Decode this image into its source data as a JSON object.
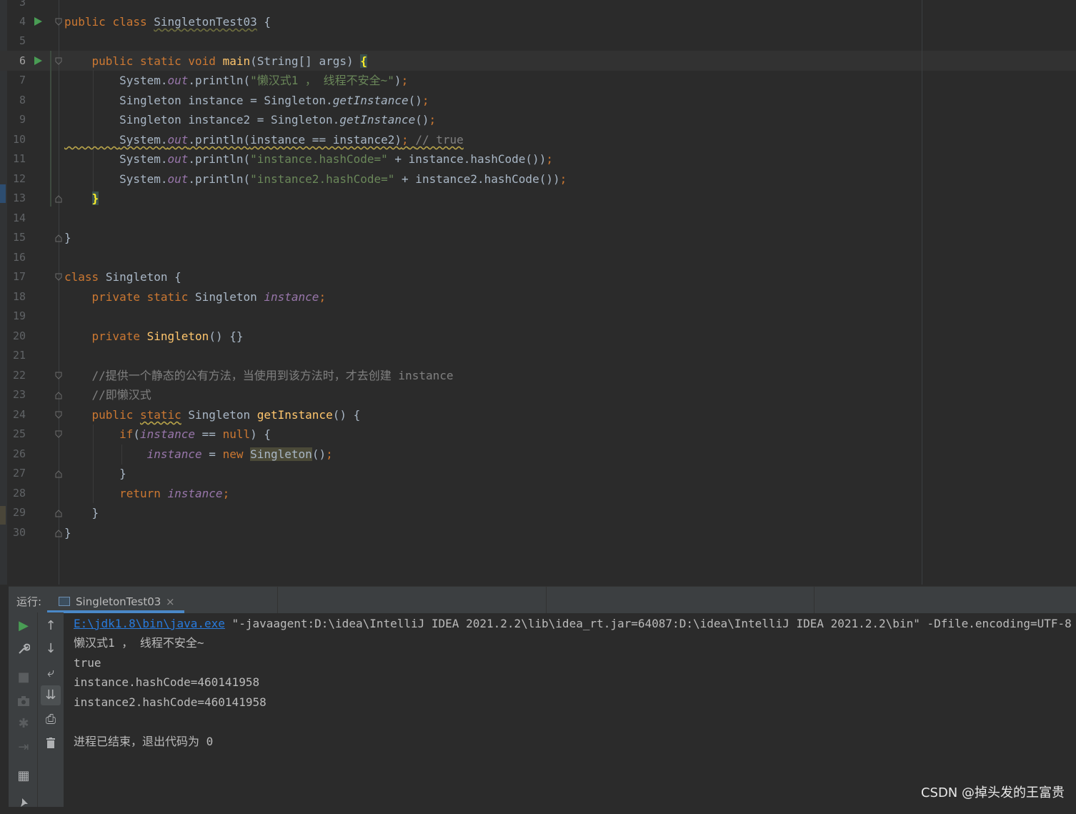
{
  "editor": {
    "lines": [
      {
        "n": "3"
      },
      {
        "n": "4"
      },
      {
        "n": "5"
      },
      {
        "n": "6"
      },
      {
        "n": "7"
      },
      {
        "n": "8"
      },
      {
        "n": "9"
      },
      {
        "n": "10"
      },
      {
        "n": "11"
      },
      {
        "n": "12"
      },
      {
        "n": "13"
      },
      {
        "n": "14"
      },
      {
        "n": "15"
      },
      {
        "n": "16"
      },
      {
        "n": "17"
      },
      {
        "n": "18"
      },
      {
        "n": "19"
      },
      {
        "n": "20"
      },
      {
        "n": "21"
      },
      {
        "n": "22"
      },
      {
        "n": "23"
      },
      {
        "n": "24"
      },
      {
        "n": "25"
      },
      {
        "n": "26"
      },
      {
        "n": "27"
      },
      {
        "n": "28"
      },
      {
        "n": "29"
      },
      {
        "n": "30"
      }
    ],
    "t": {
      "public": "public",
      "class": "class",
      "static": "static",
      "void": "void",
      "private": "private",
      "if": "if",
      "null": "null",
      "new": "new",
      "return": "return",
      "class_name": "SingletonTest03",
      "main": "main",
      "main_params": "(String[] args) ",
      "open_brace": "{",
      "close_brace": "}",
      "sys": "System.",
      "out": "out",
      "println_open": ".println(",
      "str_lazy": "\"懒汉式1 ， 线程不安全~\"",
      "close_semi": ")",
      "semi": ";",
      "singleton_instance_decl": "Singleton instance = Singleton.",
      "singleton_instance2_decl": "Singleton instance2 = Singleton.",
      "getInstance_call": "getInstance",
      "parens": "()",
      "eq_expr": "instance == instance2)",
      "comment_true": "// true",
      "str_hash1": "\"instance.hashCode=\"",
      "plus_hash1": " + instance.hashCode())",
      "str_hash2": "\"instance2.hashCode=\"",
      "plus_hash2": " + instance2.hashCode())",
      "singleton": "Singleton",
      "singleton_sp": "Singleton ",
      "instance": "instance",
      "empty_body": " {}",
      "comment1": "//提供一个静态的公有方法，当使用到该方法时，才去创建 instance",
      "comment2": "//即懒汉式",
      "getInstance": "getInstance",
      "paren_open": "(",
      "eq_null": " == ",
      "cond_close": ") {",
      "assign": " = ",
      "brace_open_sp": " {",
      "call_close": "()"
    }
  },
  "run_panel": {
    "label": "运行:",
    "tab_label": "SingletonTest03",
    "tab_close": "×",
    "console": {
      "cmd_link": "E:\\jdk1.8\\bin\\java.exe",
      "cmd_args": " \"-javaagent:D:\\idea\\IntelliJ IDEA 2021.2.2\\lib\\idea_rt.jar=64087:D:\\idea\\IntelliJ IDEA 2021.2.2\\bin\" -Dfile.encoding=UTF-8",
      "out1": "懒汉式1 ， 线程不安全~",
      "out2": "true",
      "out3": "instance.hashCode=460141958",
      "out4": "instance2.hashCode=460141958",
      "out5": "进程已结束，退出代码为 0"
    },
    "toolbar": {
      "run": "▶",
      "wrench": "🔧",
      "stop": "■",
      "camera": "📷",
      "debug": "✱",
      "login": "⇥",
      "layout": "▦",
      "pin": "📌",
      "up": "↑",
      "down": "↓",
      "wrap": "⤶",
      "scroll_end": "⇊",
      "print": "⎙",
      "trash": "🗑"
    }
  },
  "watermark": "CSDN @掉头发的王富贵"
}
